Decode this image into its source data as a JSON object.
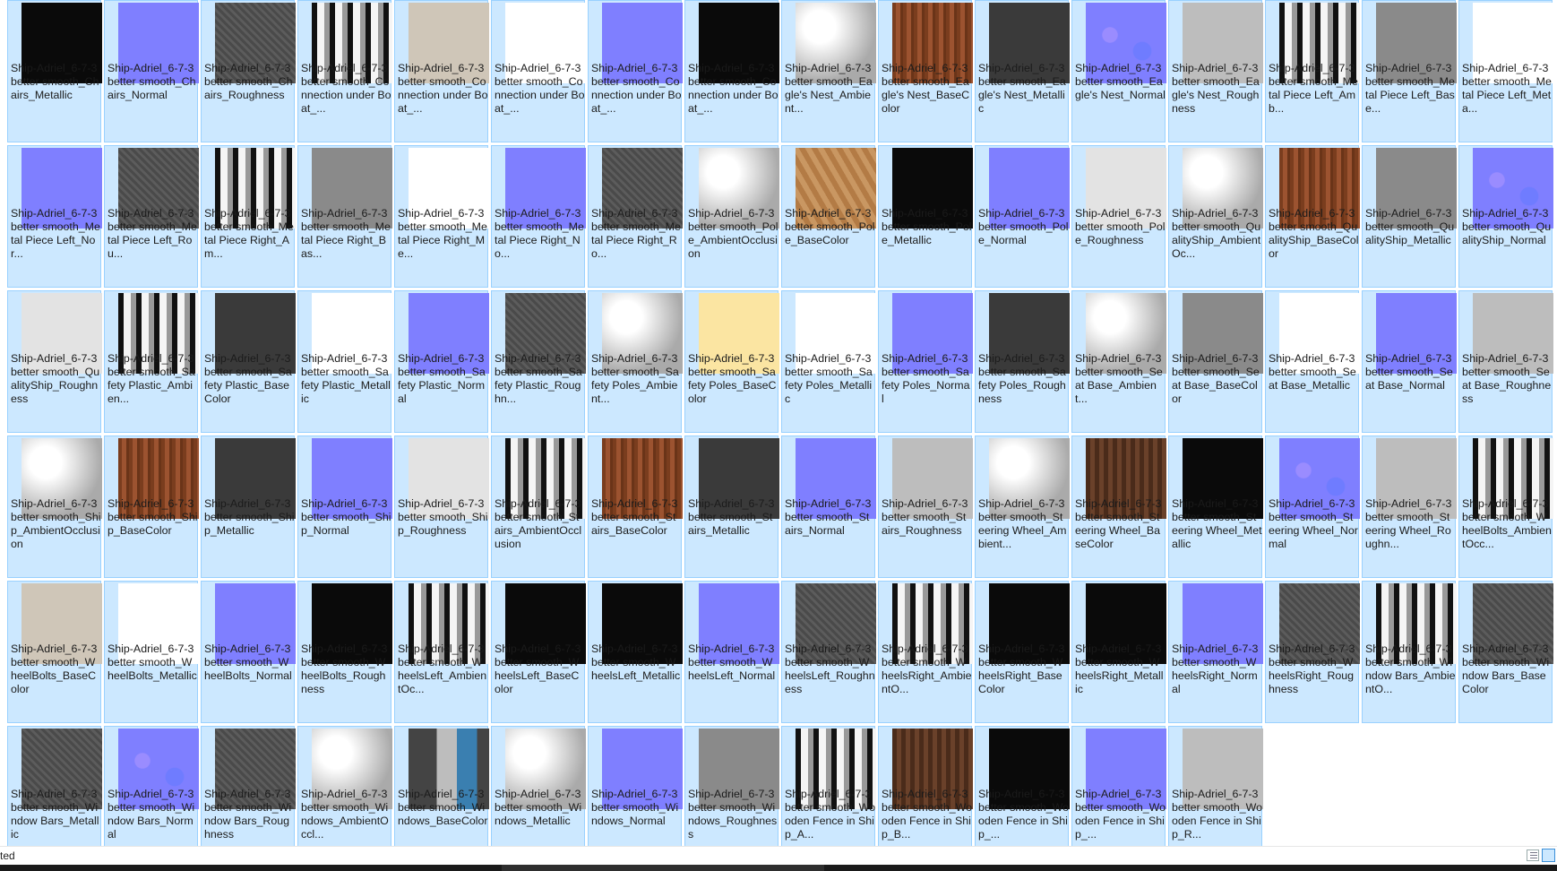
{
  "status": {
    "text": "ted"
  },
  "colors": {
    "normal": "#7c7cff",
    "tile_selected": "#cce8ff",
    "tile_border": "#99d1ff"
  },
  "files": [
    {
      "name": "Ship-Adriel_6-7-3 better smooth_Chairs_Metallic",
      "thumb": "black"
    },
    {
      "name": "Ship-Adriel_6-7-3 better smooth_Chairs_Normal",
      "thumb": "normal"
    },
    {
      "name": "Ship-Adriel_6-7-3 better smooth_Chairs_Roughness",
      "thumb": "gray-noise"
    },
    {
      "name": "Ship-Adriel_6-7-3 better smooth_Connection under Boat_...",
      "thumb": "ao-pattern"
    },
    {
      "name": "Ship-Adriel_6-7-3 better smooth_Connection under Boat_...",
      "thumb": "beige"
    },
    {
      "name": "Ship-Adriel_6-7-3 better smooth_Connection under Boat_...",
      "thumb": "white"
    },
    {
      "name": "Ship-Adriel_6-7-3 better smooth_Connection under Boat_...",
      "thumb": "normal"
    },
    {
      "name": "Ship-Adriel_6-7-3 better smooth_Connection under Boat_...",
      "thumb": "black"
    },
    {
      "name": "Ship-Adriel_6-7-3 better smooth_Eagle's Nest_Ambient...",
      "thumb": "ao-light"
    },
    {
      "name": "Ship-Adriel_6-7-3 better smooth_Eagle's Nest_BaseColor",
      "thumb": "wood"
    },
    {
      "name": "Ship-Adriel_6-7-3 better smooth_Eagle's Nest_Metallic",
      "thumb": "dark-gray"
    },
    {
      "name": "Ship-Adriel_6-7-3 better smooth_Eagle's Nest_Normal",
      "thumb": "normal-detail"
    },
    {
      "name": "Ship-Adriel_6-7-3 better smooth_Eagle's Nest_Roughness",
      "thumb": "light-gray"
    },
    {
      "name": "Ship-Adriel_6-7-3 better smooth_Metal Piece Left_Amb...",
      "thumb": "ao-pattern"
    },
    {
      "name": "Ship-Adriel_6-7-3 better smooth_Metal Piece Left_Base...",
      "thumb": "mid-gray"
    },
    {
      "name": "Ship-Adriel_6-7-3 better smooth_Metal Piece Left_Meta...",
      "thumb": "white"
    },
    {
      "name": "Ship-Adriel_6-7-3 better smooth_Metal Piece Left_Nor...",
      "thumb": "normal"
    },
    {
      "name": "Ship-Adriel_6-7-3 better smooth_Metal Piece Left_Rou...",
      "thumb": "gray-noise"
    },
    {
      "name": "Ship-Adriel_6-7-3 better smooth_Metal Piece Right_Am...",
      "thumb": "ao-pattern"
    },
    {
      "name": "Ship-Adriel_6-7-3 better smooth_Metal Piece Right_Bas...",
      "thumb": "mid-gray"
    },
    {
      "name": "Ship-Adriel_6-7-3 better smooth_Metal Piece Right_Me...",
      "thumb": "white"
    },
    {
      "name": "Ship-Adriel_6-7-3 better smooth_Metal Piece Right_No...",
      "thumb": "normal"
    },
    {
      "name": "Ship-Adriel_6-7-3 better smooth_Metal Piece Right_Ro...",
      "thumb": "gray-noise"
    },
    {
      "name": "Ship-Adriel_6-7-3 better smooth_Pole_AmbientOcclusion",
      "thumb": "ao-light"
    },
    {
      "name": "Ship-Adriel_6-7-3 better smooth_Pole_BaseColor",
      "thumb": "wood-light"
    },
    {
      "name": "Ship-Adriel_6-7-3 better smooth_Pole_Metallic",
      "thumb": "black"
    },
    {
      "name": "Ship-Adriel_6-7-3 better smooth_Pole_Normal",
      "thumb": "normal"
    },
    {
      "name": "Ship-Adriel_6-7-3 better smooth_Pole_Roughness",
      "thumb": "very-light-gray"
    },
    {
      "name": "Ship-Adriel_6-7-3 better smooth_QualityShip_AmbientOc...",
      "thumb": "ao-light"
    },
    {
      "name": "Ship-Adriel_6-7-3 better smooth_QualityShip_BaseColor",
      "thumb": "wood"
    },
    {
      "name": "Ship-Adriel_6-7-3 better smooth_QualityShip_Metallic",
      "thumb": "mid-gray"
    },
    {
      "name": "Ship-Adriel_6-7-3 better smooth_QualityShip_Normal",
      "thumb": "normal-detail"
    },
    {
      "name": "Ship-Adriel_6-7-3 better smooth_QualityShip_Roughness",
      "thumb": "very-light-gray"
    },
    {
      "name": "Ship-Adriel_6-7-3 better smooth_Safety Plastic_Ambien...",
      "thumb": "ao-pattern"
    },
    {
      "name": "Ship-Adriel_6-7-3 better smooth_Safety Plastic_BaseColor",
      "thumb": "dark-gray"
    },
    {
      "name": "Ship-Adriel_6-7-3 better smooth_Safety Plastic_Metallic",
      "thumb": "white"
    },
    {
      "name": "Ship-Adriel_6-7-3 better smooth_Safety Plastic_Normal",
      "thumb": "normal"
    },
    {
      "name": "Ship-Adriel_6-7-3 better smooth_Safety Plastic_Roughn...",
      "thumb": "gray-noise"
    },
    {
      "name": "Ship-Adriel_6-7-3 better smooth_Safety Poles_Ambient...",
      "thumb": "ao-light"
    },
    {
      "name": "Ship-Adriel_6-7-3 better smooth_Safety Poles_BaseColor",
      "thumb": "yellow"
    },
    {
      "name": "Ship-Adriel_6-7-3 better smooth_Safety Poles_Metallic",
      "thumb": "white"
    },
    {
      "name": "Ship-Adriel_6-7-3 better smooth_Safety Poles_Normal",
      "thumb": "normal"
    },
    {
      "name": "Ship-Adriel_6-7-3 better smooth_Safety Poles_Roughness",
      "thumb": "dark-gray"
    },
    {
      "name": "Ship-Adriel_6-7-3 better smooth_Seat Base_Ambient...",
      "thumb": "ao-light"
    },
    {
      "name": "Ship-Adriel_6-7-3 better smooth_Seat Base_BaseColor",
      "thumb": "mid-gray"
    },
    {
      "name": "Ship-Adriel_6-7-3 better smooth_Seat Base_Metallic",
      "thumb": "white"
    },
    {
      "name": "Ship-Adriel_6-7-3 better smooth_Seat Base_Normal",
      "thumb": "normal"
    },
    {
      "name": "Ship-Adriel_6-7-3 better smooth_Seat Base_Roughness",
      "thumb": "light-gray"
    },
    {
      "name": "Ship-Adriel_6-7-3 better smooth_Ship_AmbientOcclusion",
      "thumb": "ao-light"
    },
    {
      "name": "Ship-Adriel_6-7-3 better smooth_Ship_BaseColor",
      "thumb": "wood"
    },
    {
      "name": "Ship-Adriel_6-7-3 better smooth_Ship_Metallic",
      "thumb": "dark-gray"
    },
    {
      "name": "Ship-Adriel_6-7-3 better smooth_Ship_Normal",
      "thumb": "normal"
    },
    {
      "name": "Ship-Adriel_6-7-3 better smooth_Ship_Roughness",
      "thumb": "very-light-gray"
    },
    {
      "name": "Ship-Adriel_6-7-3 better smooth_Stairs_AmbientOcclusion",
      "thumb": "ao-pattern"
    },
    {
      "name": "Ship-Adriel_6-7-3 better smooth_Stairs_BaseColor",
      "thumb": "wood"
    },
    {
      "name": "Ship-Adriel_6-7-3 better smooth_Stairs_Metallic",
      "thumb": "dark-gray"
    },
    {
      "name": "Ship-Adriel_6-7-3 better smooth_Stairs_Normal",
      "thumb": "normal"
    },
    {
      "name": "Ship-Adriel_6-7-3 better smooth_Stairs_Roughness",
      "thumb": "light-gray"
    },
    {
      "name": "Ship-Adriel_6-7-3 better smooth_Steering Wheel_Ambient...",
      "thumb": "ao-light"
    },
    {
      "name": "Ship-Adriel_6-7-3 better smooth_Steering Wheel_BaseColor",
      "thumb": "wood-brown"
    },
    {
      "name": "Ship-Adriel_6-7-3 better smooth_Steering Wheel_Metallic",
      "thumb": "black"
    },
    {
      "name": "Ship-Adriel_6-7-3 better smooth_Steering Wheel_Normal",
      "thumb": "normal-detail"
    },
    {
      "name": "Ship-Adriel_6-7-3 better smooth_Steering Wheel_Roughn...",
      "thumb": "light-gray"
    },
    {
      "name": "Ship-Adriel_6-7-3 better smooth_WheelBolts_AmbientOcc...",
      "thumb": "ao-pattern"
    },
    {
      "name": "Ship-Adriel_6-7-3 better smooth_WheelBolts_BaseColor",
      "thumb": "beige"
    },
    {
      "name": "Ship-Adriel_6-7-3 better smooth_WheelBolts_Metallic",
      "thumb": "white"
    },
    {
      "name": "Ship-Adriel_6-7-3 better smooth_WheelBolts_Normal",
      "thumb": "normal"
    },
    {
      "name": "Ship-Adriel_6-7-3 better smooth_WheelBolts_Roughness",
      "thumb": "black"
    },
    {
      "name": "Ship-Adriel_6-7-3 better smooth_WheelsLeft_AmbientOc...",
      "thumb": "ao-pattern"
    },
    {
      "name": "Ship-Adriel_6-7-3 better smooth_WheelsLeft_BaseColor",
      "thumb": "black"
    },
    {
      "name": "Ship-Adriel_6-7-3 better smooth_WheelsLeft_Metallic",
      "thumb": "black"
    },
    {
      "name": "Ship-Adriel_6-7-3 better smooth_WheelsLeft_Normal",
      "thumb": "normal"
    },
    {
      "name": "Ship-Adriel_6-7-3 better smooth_WheelsLeft_Roughness",
      "thumb": "gray-noise"
    },
    {
      "name": "Ship-Adriel_6-7-3 better smooth_WheelsRight_AmbientO...",
      "thumb": "ao-pattern"
    },
    {
      "name": "Ship-Adriel_6-7-3 better smooth_WheelsRight_BaseColor",
      "thumb": "black"
    },
    {
      "name": "Ship-Adriel_6-7-3 better smooth_WheelsRight_Metallic",
      "thumb": "black"
    },
    {
      "name": "Ship-Adriel_6-7-3 better smooth_WheelsRight_Normal",
      "thumb": "normal"
    },
    {
      "name": "Ship-Adriel_6-7-3 better smooth_WheelsRight_Roughness",
      "thumb": "gray-noise"
    },
    {
      "name": "Ship-Adriel_6-7-3 better smooth_Window Bars_AmbientO...",
      "thumb": "ao-pattern"
    },
    {
      "name": "Ship-Adriel_6-7-3 better smooth_Window Bars_BaseColor",
      "thumb": "gray-noise"
    },
    {
      "name": "Ship-Adriel_6-7-3 better smooth_Window Bars_Metallic",
      "thumb": "gray-noise"
    },
    {
      "name": "Ship-Adriel_6-7-3 better smooth_Window Bars_Normal",
      "thumb": "normal-detail"
    },
    {
      "name": "Ship-Adriel_6-7-3 better smooth_Window Bars_Roughness",
      "thumb": "gray-noise"
    },
    {
      "name": "Ship-Adriel_6-7-3 better smooth_Windows_AmbientOccl...",
      "thumb": "ao-light"
    },
    {
      "name": "Ship-Adriel_6-7-3 better smooth_Windows_BaseColor",
      "thumb": "windows-color"
    },
    {
      "name": "Ship-Adriel_6-7-3 better smooth_Windows_Metallic",
      "thumb": "ao-light"
    },
    {
      "name": "Ship-Adriel_6-7-3 better smooth_Windows_Normal",
      "thumb": "normal"
    },
    {
      "name": "Ship-Adriel_6-7-3 better smooth_Windows_Roughness",
      "thumb": "mid-gray"
    },
    {
      "name": "Ship-Adriel_6-7-3 better smooth_Wooden Fence in Ship_A...",
      "thumb": "ao-pattern"
    },
    {
      "name": "Ship-Adriel_6-7-3 better smooth_Wooden Fence in Ship_B...",
      "thumb": "wood-brown"
    },
    {
      "name": "Ship-Adriel_6-7-3 better smooth_Wooden Fence in Ship_...",
      "thumb": "black"
    },
    {
      "name": "Ship-Adriel_6-7-3 better smooth_Wooden Fence in Ship_...",
      "thumb": "normal"
    },
    {
      "name": "Ship-Adriel_6-7-3 better smooth_Wooden Fence in Ship_R...",
      "thumb": "light-gray"
    }
  ]
}
